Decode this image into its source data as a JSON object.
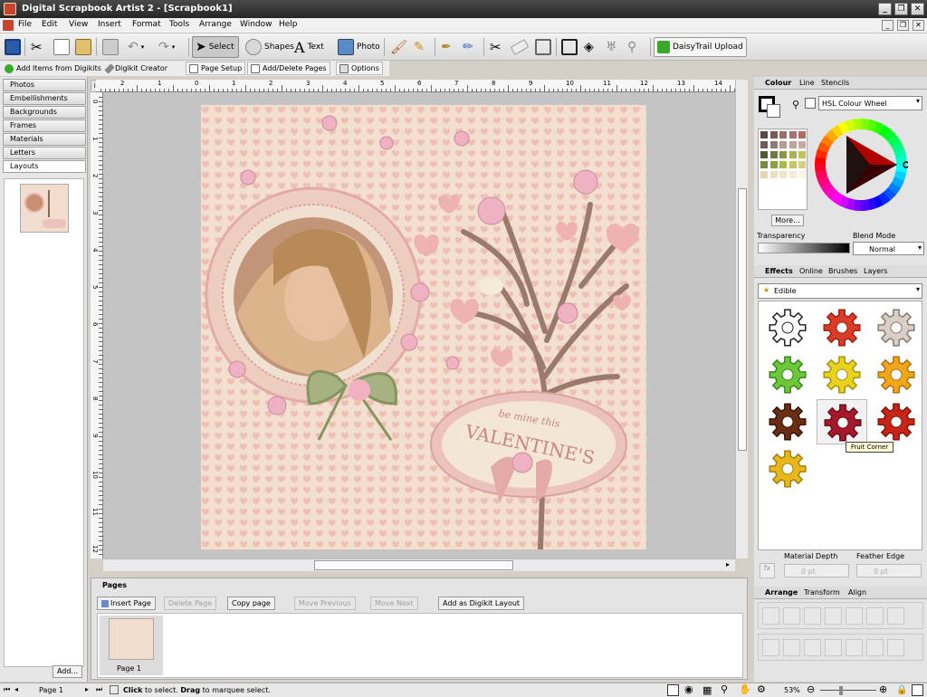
{
  "window": {
    "title": "Digital Scrapbook Artist 2 - [Scrapbook1]"
  },
  "menu": [
    "File",
    "Edit",
    "View",
    "Insert",
    "Format",
    "Tools",
    "Arrange",
    "Window",
    "Help"
  ],
  "toolbar": {
    "select": "Select",
    "shapes": "Shapes",
    "text": "Text",
    "photo": "Photo",
    "daisytrail": "DaisyTrail Upload"
  },
  "toolbar2": {
    "add_items": "Add Items from Digikits",
    "digikit_creator": "Digikit Creator",
    "page_setup": "Page Setup",
    "add_delete_pages": "Add/Delete Pages",
    "options": "Options"
  },
  "left_tabs": [
    "Photos",
    "Embellishments",
    "Backgrounds",
    "Frames",
    "Materials",
    "Letters",
    "Layouts"
  ],
  "left_add": "Add...",
  "ruler_h": [
    "2",
    "1",
    "0",
    "1",
    "2",
    "3",
    "4",
    "5",
    "6",
    "7",
    "8",
    "9",
    "10",
    "11",
    "12",
    "13",
    "14"
  ],
  "ruler_v": [
    "0",
    "1",
    "2",
    "3",
    "4",
    "5",
    "6",
    "7",
    "8",
    "9",
    "10",
    "11",
    "12"
  ],
  "ruler_unit": "in",
  "page_art": {
    "banner_small": "be mine this",
    "banner_big": "VALENTINE'S"
  },
  "pages_panel": {
    "title": "Pages",
    "insert": "Insert Page",
    "delete": "Delete Page",
    "copy": "Copy page",
    "move_prev": "Move Previous",
    "move_next": "Move Next",
    "add_layout": "Add as Digikit Layout",
    "thumb_label": "Page 1"
  },
  "colour_panel": {
    "tabs": [
      "Colour",
      "Line",
      "Stencils"
    ],
    "mode": "HSL Colour Wheel",
    "more": "More...",
    "transparency": "Transparency",
    "blend_mode_label": "Blend Mode",
    "blend_mode": "Normal",
    "swatches": [
      "#5a4644",
      "#7d5c58",
      "#9d6f6a",
      "#a86f73",
      "#b26b6b",
      "#6e5a56",
      "#907a74",
      "#b59a92",
      "#bfa29a",
      "#c9aaa6",
      "#4f5a34",
      "#6d7a3d",
      "#8d9648",
      "#aab055",
      "#c1c25a",
      "#7a8a3c",
      "#8fa040",
      "#b0b84a",
      "#c8c46a",
      "#d8d080",
      "#e0d8b0",
      "#e8e0c0",
      "#efe6c8",
      "#f4ecd8",
      "#faf4e6"
    ]
  },
  "effects_panel": {
    "tabs": [
      "Effects",
      "Online",
      "Brushes",
      "Layers"
    ],
    "category": "Edible",
    "tooltip": "Fruit Corner",
    "material_depth": "Material Depth",
    "feather_edge": "Feather Edge",
    "md_value": "0 pt",
    "fe_value": "0 pt",
    "gears": [
      {
        "name": "plain",
        "fill": "#ffffff",
        "stroke": "#222222"
      },
      {
        "name": "red",
        "fill": "#d93c28",
        "stroke": "#a02010"
      },
      {
        "name": "chocolate-light",
        "fill": "#d8d0c8",
        "stroke": "#8a7a6a"
      },
      {
        "name": "green",
        "fill": "#6cc83a",
        "stroke": "#3a8a1a"
      },
      {
        "name": "yellow",
        "fill": "#e8d21c",
        "stroke": "#a89010"
      },
      {
        "name": "orange",
        "fill": "#f0a81a",
        "stroke": "#b07010"
      },
      {
        "name": "chocolate",
        "fill": "#6b2e14",
        "stroke": "#3a1808"
      },
      {
        "name": "fruit-corner",
        "fill": "#a8182c",
        "stroke": "#6a0c18"
      },
      {
        "name": "fruit",
        "fill": "#c82418",
        "stroke": "#801808"
      },
      {
        "name": "cheese",
        "fill": "#e8b818",
        "stroke": "#a08010"
      }
    ]
  },
  "arrange_panel": {
    "tabs": [
      "Arrange",
      "Transform",
      "Align"
    ]
  },
  "statusbar": {
    "page": "Page 1",
    "hint_click": "Click",
    "hint_a": " to select. ",
    "hint_drag": "Drag",
    "hint_b": " to marquee select.",
    "zoom": "53%"
  },
  "colors": {
    "accent": "#4a4a4a",
    "page_bg": "#f3dfcf",
    "heart": "#eeb3ac",
    "oval": "#ecc2be",
    "banner_text": "#c9847f",
    "ribbon": "#9eaa7a"
  }
}
